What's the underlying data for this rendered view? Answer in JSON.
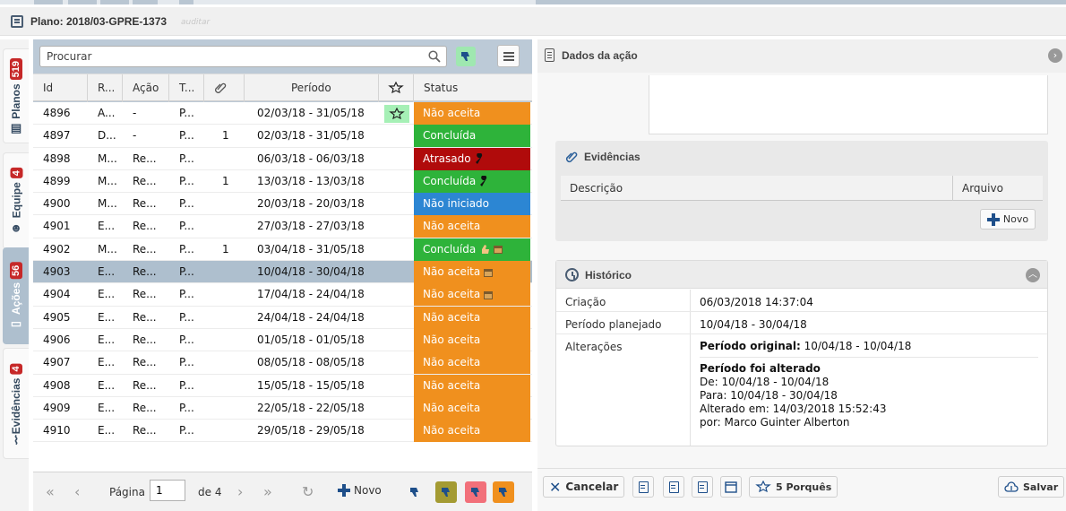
{
  "title": "Plano: 2018/03-GPRE-1373",
  "title_sub": "auditar",
  "sidebar": [
    {
      "label": "Planos",
      "badge": "519"
    },
    {
      "label": "Equipe",
      "badge": "4"
    },
    {
      "label": "Ações",
      "badge": "56"
    },
    {
      "label": "Evidências",
      "badge": "4"
    }
  ],
  "search": {
    "placeholder": "Procurar"
  },
  "columns": [
    "Id",
    "R...",
    "Ação",
    "T...",
    "",
    "Período",
    "",
    "Status"
  ],
  "rows": [
    {
      "id": "4896",
      "r": "A...",
      "acao": "-",
      "t": "P...",
      "n": "",
      "periodo": "02/03/18 - 31/05/18",
      "star": true,
      "status": "Não aceita",
      "color": "#f0901e",
      "icons": []
    },
    {
      "id": "4897",
      "r": "D...",
      "acao": "-",
      "t": "P...",
      "n": "1",
      "periodo": "02/03/18 - 31/05/18",
      "star": false,
      "status": "Concluída",
      "color": "#2eb33a",
      "icons": []
    },
    {
      "id": "4898",
      "r": "M...",
      "acao": "Re...",
      "t": "P...",
      "n": "",
      "periodo": "06/03/18 - 06/03/18",
      "star": false,
      "status": "Atrasado",
      "color": "#b00b0b",
      "icons": [
        "wrench-icon"
      ]
    },
    {
      "id": "4899",
      "r": "M...",
      "acao": "Re...",
      "t": "P...",
      "n": "1",
      "periodo": "13/03/18 - 13/03/18",
      "star": false,
      "status": "Concluída",
      "color": "#2eb33a",
      "icons": [
        "wrench-icon"
      ]
    },
    {
      "id": "4900",
      "r": "M...",
      "acao": "Re...",
      "t": "P...",
      "n": "",
      "periodo": "20/03/18 - 20/03/18",
      "star": false,
      "status": "Não iniciado",
      "color": "#2c86d3",
      "icons": []
    },
    {
      "id": "4901",
      "r": "E...",
      "acao": "Re...",
      "t": "P...",
      "n": "",
      "periodo": "27/03/18 - 27/03/18",
      "star": false,
      "status": "Não aceita",
      "color": "#f0901e",
      "icons": []
    },
    {
      "id": "4902",
      "r": "M...",
      "acao": "Re...",
      "t": "P...",
      "n": "1",
      "periodo": "03/04/18 - 31/05/18",
      "star": false,
      "status": "Concluída",
      "color": "#2eb33a",
      "icons": [
        "thumbs-up-icon",
        "calendar-icon"
      ]
    },
    {
      "id": "4903",
      "r": "E...",
      "acao": "Re...",
      "t": "P...",
      "n": "",
      "periodo": "10/04/18 - 30/04/18",
      "star": false,
      "status": "Não aceita",
      "color": "#f0901e",
      "icons": [
        "calendar-icon"
      ],
      "selected": true
    },
    {
      "id": "4904",
      "r": "E...",
      "acao": "Re...",
      "t": "P...",
      "n": "",
      "periodo": "17/04/18 - 24/04/18",
      "star": false,
      "status": "Não aceita",
      "color": "#f0901e",
      "icons": [
        "calendar-icon"
      ]
    },
    {
      "id": "4905",
      "r": "E...",
      "acao": "Re...",
      "t": "P...",
      "n": "",
      "periodo": "24/04/18 - 24/04/18",
      "star": false,
      "status": "Não aceita",
      "color": "#f0901e",
      "icons": []
    },
    {
      "id": "4906",
      "r": "E...",
      "acao": "Re...",
      "t": "P...",
      "n": "",
      "periodo": "01/05/18 - 01/05/18",
      "star": false,
      "status": "Não aceita",
      "color": "#f0901e",
      "icons": []
    },
    {
      "id": "4907",
      "r": "E...",
      "acao": "Re...",
      "t": "P...",
      "n": "",
      "periodo": "08/05/18 - 08/05/18",
      "star": false,
      "status": "Não aceita",
      "color": "#f0901e",
      "icons": []
    },
    {
      "id": "4908",
      "r": "E...",
      "acao": "Re...",
      "t": "P...",
      "n": "",
      "periodo": "15/05/18 - 15/05/18",
      "star": false,
      "status": "Não aceita",
      "color": "#f0901e",
      "icons": []
    },
    {
      "id": "4909",
      "r": "E...",
      "acao": "Re...",
      "t": "P...",
      "n": "",
      "periodo": "22/05/18 - 22/05/18",
      "star": false,
      "status": "Não aceita",
      "color": "#f0901e",
      "icons": []
    },
    {
      "id": "4910",
      "r": "E...",
      "acao": "Re...",
      "t": "P...",
      "n": "",
      "periodo": "29/05/18 - 29/05/18",
      "star": false,
      "status": "Não aceita",
      "color": "#f0901e",
      "icons": []
    }
  ],
  "pager": {
    "page_label": "Página",
    "page_value": "1",
    "of_label": "de 4",
    "new_label": "Novo"
  },
  "right": {
    "title": "Dados da ação",
    "evidencias": {
      "title": "Evidências",
      "col_desc": "Descrição",
      "col_file": "Arquivo",
      "new_label": "Novo"
    },
    "historico": {
      "title": "Histórico",
      "criacao_label": "Criação",
      "criacao_value": "06/03/2018 14:37:04",
      "periodo_label": "Período planejado",
      "periodo_value": "10/04/18 - 30/04/18",
      "alteracoes_label": "Alterações",
      "original_label": "Período original:",
      "original_value": "10/04/18 - 10/04/18",
      "changed_title": "Período foi alterado",
      "de": "De: 10/04/18 - 10/04/18",
      "para": "Para: 10/04/18 - 30/04/18",
      "alterado": "Alterado em: 14/03/2018 15:52:43",
      "por": "por: Marco Guinter Alberton"
    },
    "footer": {
      "cancel": "Cancelar",
      "porques": "5 Porquês",
      "save": "Salvar"
    }
  },
  "colors": {
    "accent": "#1e4f8a",
    "panel": "#bccad7",
    "orange": "#f0901e",
    "green": "#2eb33a",
    "red": "#b00b0b",
    "blue": "#2c86d3"
  }
}
